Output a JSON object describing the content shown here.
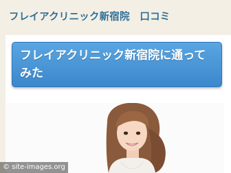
{
  "header": {
    "site_title": "フレイアクリニック新宿院　口コミ"
  },
  "post": {
    "title": "フレイアクリニック新宿院に通ってみた"
  },
  "watermark": {
    "text": "© site-images.org"
  },
  "colors": {
    "page_background": "#f4efe4",
    "title_text": "#2f6f96",
    "title_box_top": "#5aa6e1",
    "title_box_bottom": "#3b87cc"
  }
}
